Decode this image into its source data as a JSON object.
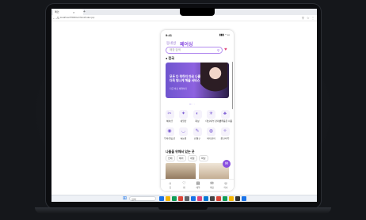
{
  "browser": {
    "tab_title": "메인",
    "tab_close": "×",
    "tab_add": "+",
    "url": "localhost:5500/src/html/index.jsp",
    "nav_icons": [
      "arrow-left-icon",
      "arrow-right-icon",
      "reload-icon"
    ],
    "ext_icons": [
      "zoom-icon",
      "star-icon",
      "menu-icon"
    ]
  },
  "app": {
    "status_time": "9:41",
    "status_icons": "▮▮▮ ◔ ▭",
    "brand_small": "동네방",
    "brand_big": "페어싱",
    "search_placeholder": "매장 검색",
    "location": "전국",
    "banner": {
      "title": "모두 다 착하지 마요 나를 더욱 빛나게 해줄 서비스",
      "subtitle": "지금 바로 예약하기"
    },
    "categories": [
      {
        "label": "헤어샵",
        "icon": "✂"
      },
      {
        "label": "네일샵",
        "icon": "✦"
      },
      {
        "label": "왁싱",
        "icon": "◐"
      },
      {
        "label": "태닝/피부 관리샵",
        "icon": "☀"
      },
      {
        "label": "반려동물 미용",
        "icon": "♣"
      },
      {
        "label": "두피/탈모샵",
        "icon": "◉"
      },
      {
        "label": "속눈썹",
        "icon": "◡"
      },
      {
        "label": "반영구",
        "icon": "✎"
      },
      {
        "label": "바디관리",
        "icon": "◍"
      },
      {
        "label": "문신/타투",
        "icon": "✧"
      }
    ],
    "section_title": "나들을 위해서 있는 곳",
    "chips": [
      "전체",
      "헤어",
      "네일",
      "왁싱"
    ],
    "bottom_nav": [
      {
        "label": "홈",
        "icon": "⌂"
      },
      {
        "label": "찜",
        "icon": "♡"
      },
      {
        "label": "예약",
        "icon": "▤"
      },
      {
        "label": "채팅",
        "icon": "✉"
      },
      {
        "label": "마이",
        "icon": "☺"
      }
    ],
    "colors": {
      "accent": "#8a50e0",
      "heart": "#e0457a"
    }
  },
  "taskbar": {
    "search_placeholder": "검색",
    "apps": [
      "#1a73e8",
      "#f4b400",
      "#0f9d58",
      "#db4437",
      "#5f6368",
      "#1a73e8",
      "#e0457a",
      "#0078d4",
      "#444",
      "#db4437",
      "#0f9d58",
      "#f4b400",
      "#333",
      "#1a73e8"
    ]
  }
}
